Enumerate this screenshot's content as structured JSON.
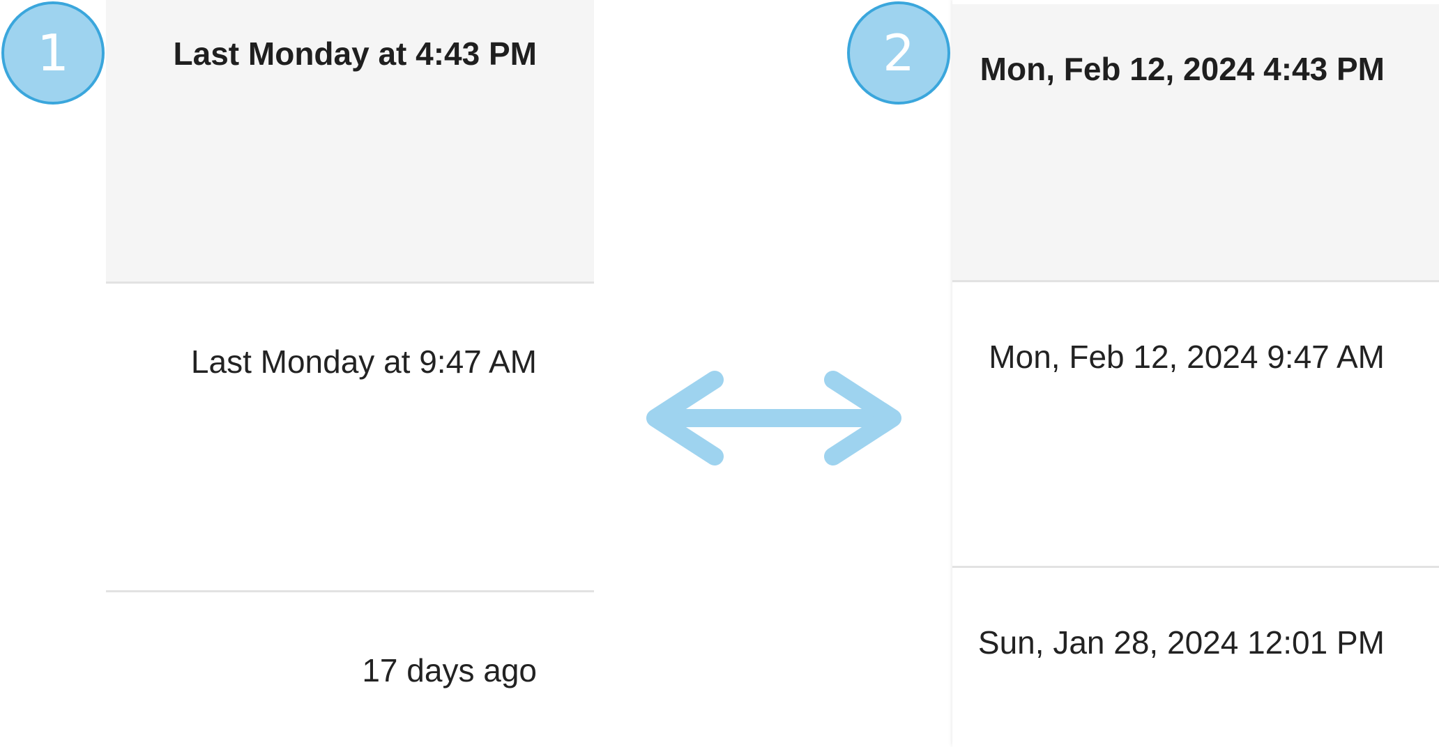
{
  "badges": [
    "1",
    "2"
  ],
  "left_panel": {
    "rows": [
      {
        "label": "Last Monday at 4:43 PM",
        "selected": true
      },
      {
        "label": "Last Monday at 9:47 AM",
        "selected": false
      },
      {
        "label": "17 days ago",
        "selected": false
      }
    ]
  },
  "right_panel": {
    "rows": [
      {
        "label": "Mon, Feb 12, 2024 4:43 PM",
        "selected": true
      },
      {
        "label": "Mon, Feb 12, 2024 9:47 AM",
        "selected": false
      },
      {
        "label": "Sun, Jan 28, 2024 12:01 PM",
        "selected": false
      }
    ]
  },
  "arrow": {
    "icon": "double-arrow-icon",
    "color": "#9ed3ef"
  },
  "colors": {
    "badge_fill": "#9ed3ef",
    "badge_border": "#3aa6dc",
    "selected_row": "#f5f5f5",
    "divider": "#e2e2e2"
  }
}
